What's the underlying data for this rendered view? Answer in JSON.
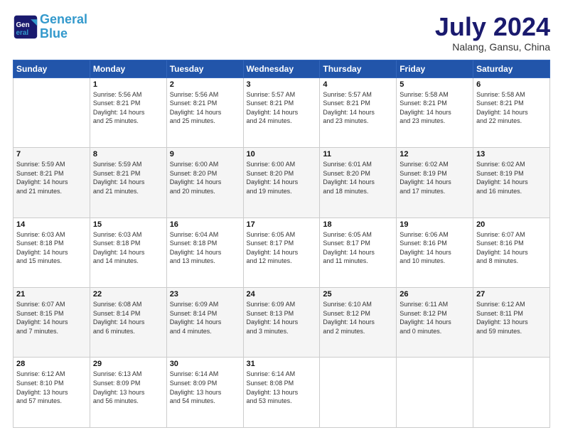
{
  "header": {
    "logo_line1": "General",
    "logo_line2": "Blue",
    "month": "July 2024",
    "location": "Nalang, Gansu, China"
  },
  "weekdays": [
    "Sunday",
    "Monday",
    "Tuesday",
    "Wednesday",
    "Thursday",
    "Friday",
    "Saturday"
  ],
  "weeks": [
    [
      {
        "day": "",
        "info": ""
      },
      {
        "day": "1",
        "info": "Sunrise: 5:56 AM\nSunset: 8:21 PM\nDaylight: 14 hours\nand 25 minutes."
      },
      {
        "day": "2",
        "info": "Sunrise: 5:56 AM\nSunset: 8:21 PM\nDaylight: 14 hours\nand 25 minutes."
      },
      {
        "day": "3",
        "info": "Sunrise: 5:57 AM\nSunset: 8:21 PM\nDaylight: 14 hours\nand 24 minutes."
      },
      {
        "day": "4",
        "info": "Sunrise: 5:57 AM\nSunset: 8:21 PM\nDaylight: 14 hours\nand 23 minutes."
      },
      {
        "day": "5",
        "info": "Sunrise: 5:58 AM\nSunset: 8:21 PM\nDaylight: 14 hours\nand 23 minutes."
      },
      {
        "day": "6",
        "info": "Sunrise: 5:58 AM\nSunset: 8:21 PM\nDaylight: 14 hours\nand 22 minutes."
      }
    ],
    [
      {
        "day": "7",
        "info": "Sunrise: 5:59 AM\nSunset: 8:21 PM\nDaylight: 14 hours\nand 21 minutes."
      },
      {
        "day": "8",
        "info": "Sunrise: 5:59 AM\nSunset: 8:21 PM\nDaylight: 14 hours\nand 21 minutes."
      },
      {
        "day": "9",
        "info": "Sunrise: 6:00 AM\nSunset: 8:20 PM\nDaylight: 14 hours\nand 20 minutes."
      },
      {
        "day": "10",
        "info": "Sunrise: 6:00 AM\nSunset: 8:20 PM\nDaylight: 14 hours\nand 19 minutes."
      },
      {
        "day": "11",
        "info": "Sunrise: 6:01 AM\nSunset: 8:20 PM\nDaylight: 14 hours\nand 18 minutes."
      },
      {
        "day": "12",
        "info": "Sunrise: 6:02 AM\nSunset: 8:19 PM\nDaylight: 14 hours\nand 17 minutes."
      },
      {
        "day": "13",
        "info": "Sunrise: 6:02 AM\nSunset: 8:19 PM\nDaylight: 14 hours\nand 16 minutes."
      }
    ],
    [
      {
        "day": "14",
        "info": "Sunrise: 6:03 AM\nSunset: 8:18 PM\nDaylight: 14 hours\nand 15 minutes."
      },
      {
        "day": "15",
        "info": "Sunrise: 6:03 AM\nSunset: 8:18 PM\nDaylight: 14 hours\nand 14 minutes."
      },
      {
        "day": "16",
        "info": "Sunrise: 6:04 AM\nSunset: 8:18 PM\nDaylight: 14 hours\nand 13 minutes."
      },
      {
        "day": "17",
        "info": "Sunrise: 6:05 AM\nSunset: 8:17 PM\nDaylight: 14 hours\nand 12 minutes."
      },
      {
        "day": "18",
        "info": "Sunrise: 6:05 AM\nSunset: 8:17 PM\nDaylight: 14 hours\nand 11 minutes."
      },
      {
        "day": "19",
        "info": "Sunrise: 6:06 AM\nSunset: 8:16 PM\nDaylight: 14 hours\nand 10 minutes."
      },
      {
        "day": "20",
        "info": "Sunrise: 6:07 AM\nSunset: 8:16 PM\nDaylight: 14 hours\nand 8 minutes."
      }
    ],
    [
      {
        "day": "21",
        "info": "Sunrise: 6:07 AM\nSunset: 8:15 PM\nDaylight: 14 hours\nand 7 minutes."
      },
      {
        "day": "22",
        "info": "Sunrise: 6:08 AM\nSunset: 8:14 PM\nDaylight: 14 hours\nand 6 minutes."
      },
      {
        "day": "23",
        "info": "Sunrise: 6:09 AM\nSunset: 8:14 PM\nDaylight: 14 hours\nand 4 minutes."
      },
      {
        "day": "24",
        "info": "Sunrise: 6:09 AM\nSunset: 8:13 PM\nDaylight: 14 hours\nand 3 minutes."
      },
      {
        "day": "25",
        "info": "Sunrise: 6:10 AM\nSunset: 8:12 PM\nDaylight: 14 hours\nand 2 minutes."
      },
      {
        "day": "26",
        "info": "Sunrise: 6:11 AM\nSunset: 8:12 PM\nDaylight: 14 hours\nand 0 minutes."
      },
      {
        "day": "27",
        "info": "Sunrise: 6:12 AM\nSunset: 8:11 PM\nDaylight: 13 hours\nand 59 minutes."
      }
    ],
    [
      {
        "day": "28",
        "info": "Sunrise: 6:12 AM\nSunset: 8:10 PM\nDaylight: 13 hours\nand 57 minutes."
      },
      {
        "day": "29",
        "info": "Sunrise: 6:13 AM\nSunset: 8:09 PM\nDaylight: 13 hours\nand 56 minutes."
      },
      {
        "day": "30",
        "info": "Sunrise: 6:14 AM\nSunset: 8:09 PM\nDaylight: 13 hours\nand 54 minutes."
      },
      {
        "day": "31",
        "info": "Sunrise: 6:14 AM\nSunset: 8:08 PM\nDaylight: 13 hours\nand 53 minutes."
      },
      {
        "day": "",
        "info": ""
      },
      {
        "day": "",
        "info": ""
      },
      {
        "day": "",
        "info": ""
      }
    ]
  ]
}
